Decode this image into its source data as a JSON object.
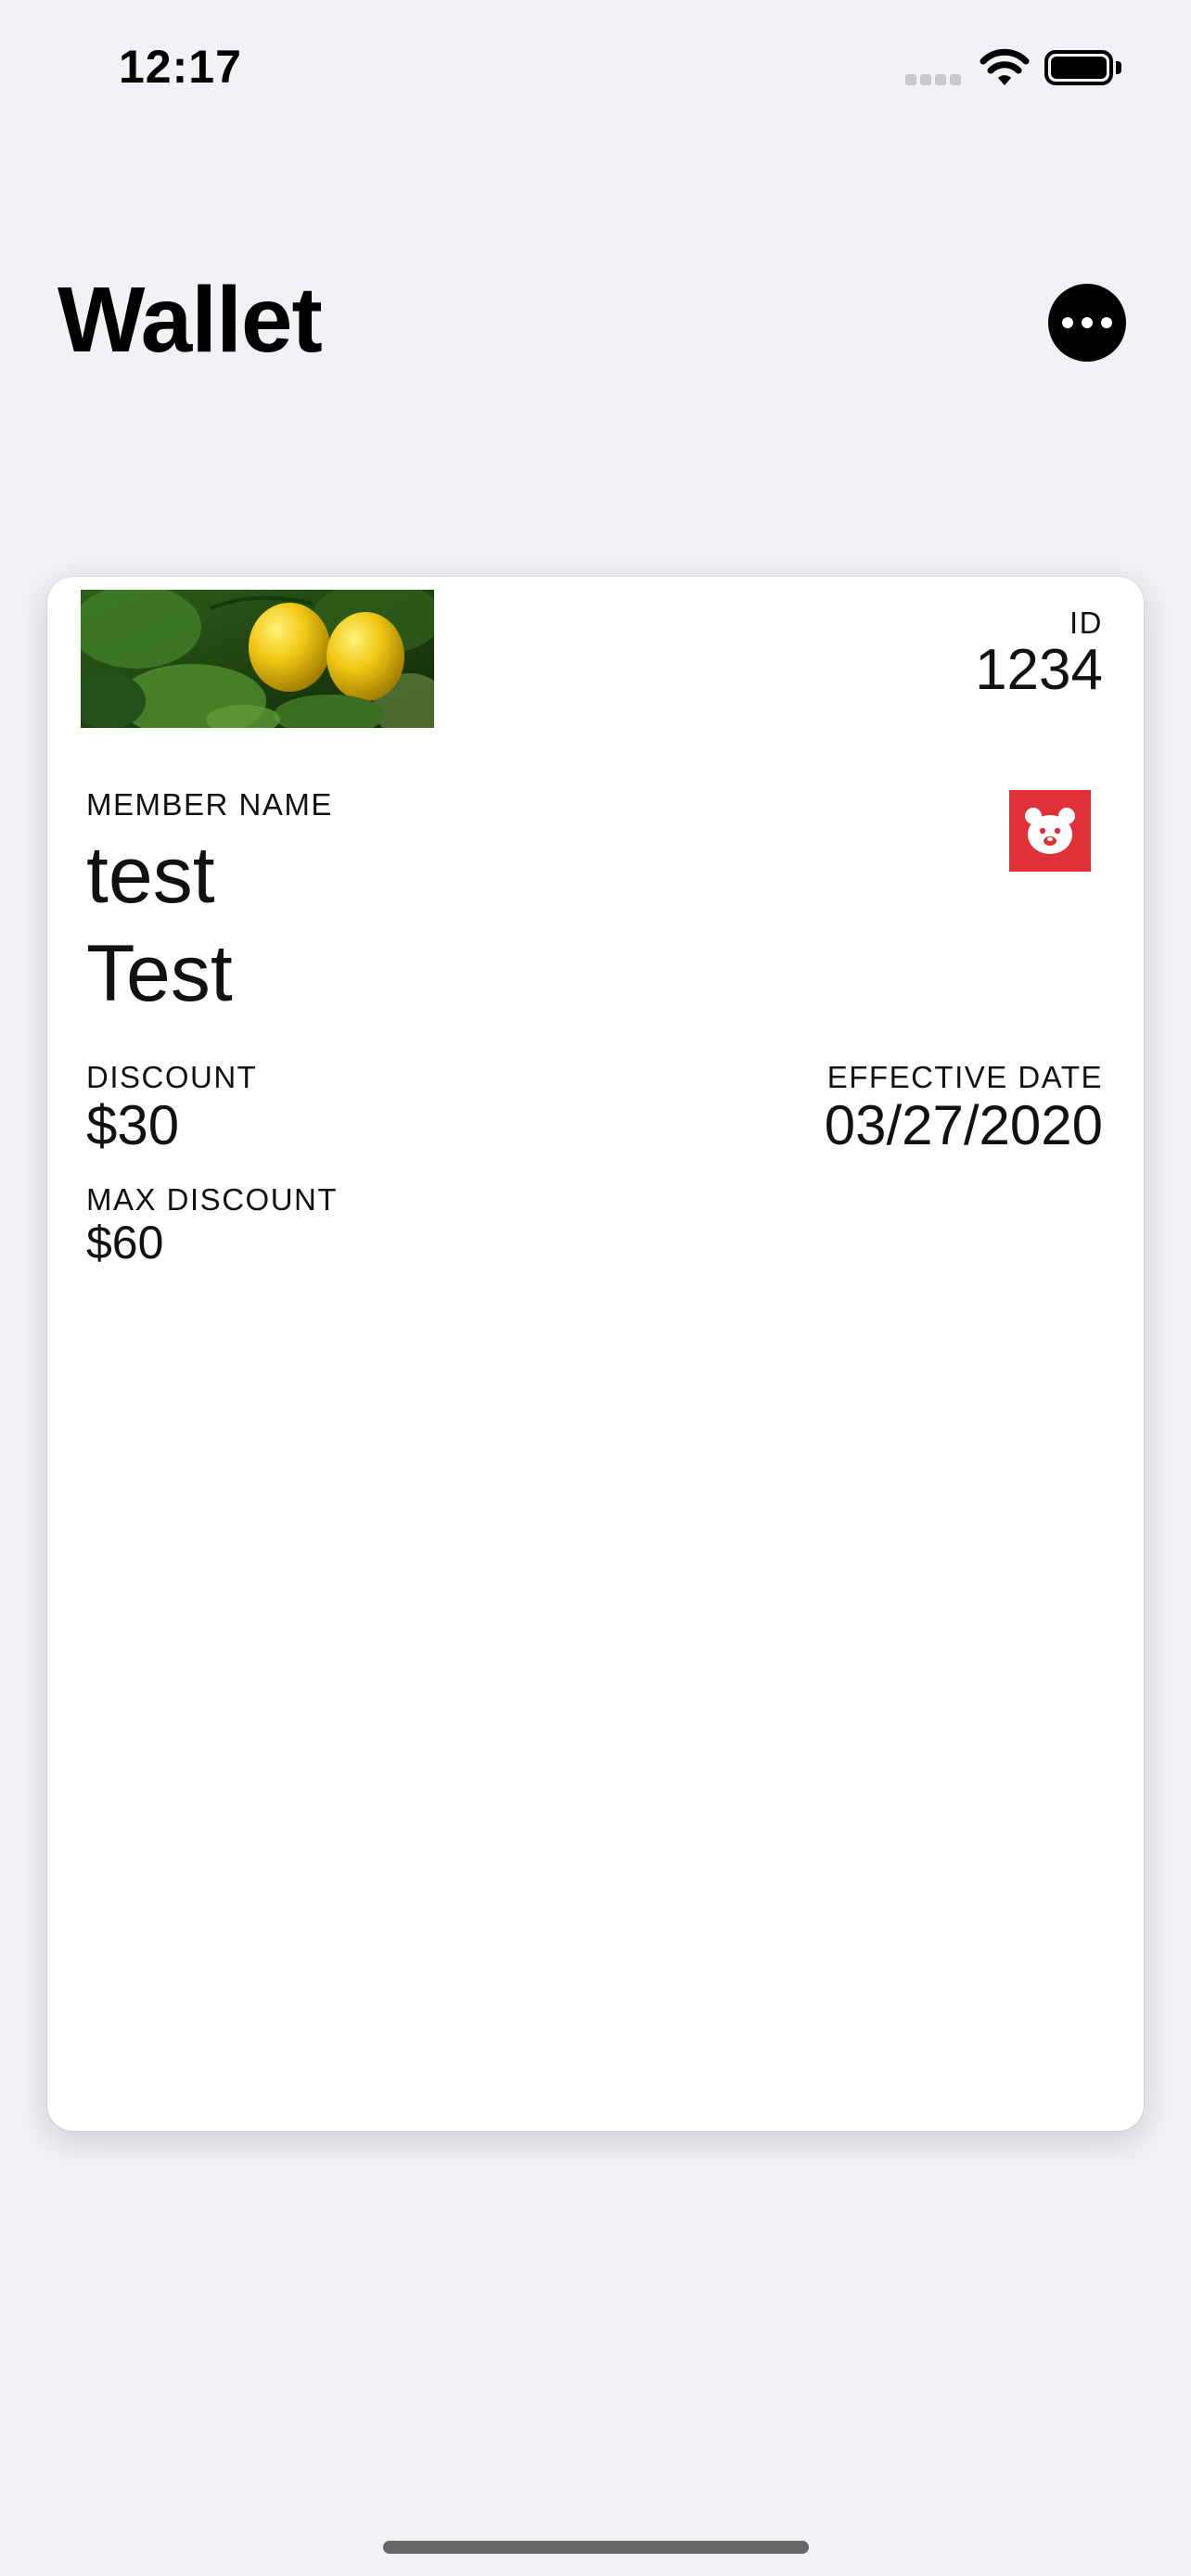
{
  "status_bar": {
    "time": "12:17",
    "icons": [
      "signal-icon",
      "wifi-icon",
      "battery-icon"
    ]
  },
  "header": {
    "title": "Wallet",
    "more_icon": "ellipsis-icon"
  },
  "card": {
    "image": "lemons-photo",
    "logo_icon": "bear-logo-icon",
    "accent_color": "#e03038",
    "id": {
      "label": "ID",
      "value": "1234"
    },
    "member": {
      "label": "MEMBER NAME",
      "line1": "test",
      "line2": "Test"
    },
    "discount": {
      "label": "DISCOUNT",
      "value": "$30"
    },
    "effective_date": {
      "label": "EFFECTIVE DATE",
      "value": "03/27/2020"
    },
    "max_discount": {
      "label": "MAX DISCOUNT",
      "value": "$60"
    }
  }
}
